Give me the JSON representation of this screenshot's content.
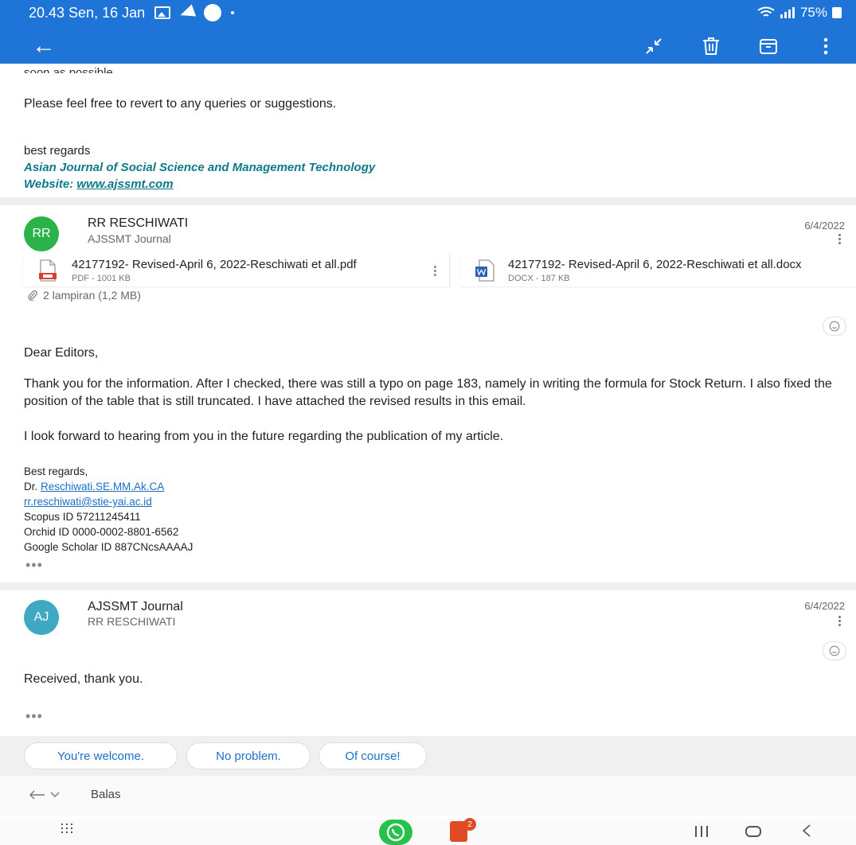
{
  "status": {
    "time_date": "20.43  Sen, 16 Jan",
    "battery": "75%"
  },
  "thread": {
    "prev_message": {
      "truncated_line": "soon as possible.",
      "body": "Please feel free to revert to any queries or suggestions.",
      "closing": "best regards",
      "org": "Asian Journal of Social Science and Management Technology",
      "website_label": "Website:",
      "website_link": "www.ajssmt.com"
    },
    "message1": {
      "avatar": "RR",
      "avatar_color": "#2bb34a",
      "sender": "RR RESCHIWATI",
      "recipient": "AJSSMT Journal",
      "date": "6/4/2022",
      "attachments": [
        {
          "name": "42177192- Revised-April 6, 2022-Reschiwati et all.pdf",
          "size": "PDF - 1001 KB"
        },
        {
          "name": "42177192- Revised-April 6, 2022-Reschiwati et all.docx",
          "size": "DOCX - 187 KB"
        }
      ],
      "attachment_count": "2 lampiran (1,2 MB)",
      "greeting": "Dear Editors,",
      "para1": "Thank you for the information. After I checked, there was still a typo on page 183, namely in writing the formula for Stock Return. I also fixed the position of the table that is still truncated. I have attached the revised results in this email.",
      "para2": "I look forward to hearing from you in the future regarding the publication of my article.",
      "signature": {
        "closing": "Best regards,",
        "title_prefix": "Dr.",
        "name_link": "Reschiwati.SE.MM.Ak.CA",
        "email_link": "rr.reschiwati@stie-yai.ac.id",
        "scopus": "Scopus ID 57211245411",
        "orchid": "Orchid ID 0000-0002-8801-6562",
        "scholar": "Google Scholar ID 887CNcsAAAAJ"
      }
    },
    "message2": {
      "avatar": "AJ",
      "avatar_color": "#3fa9c4",
      "sender": "AJSSMT Journal",
      "recipient": "RR RESCHIWATI",
      "date": "6/4/2022",
      "body": "Received, thank you."
    }
  },
  "smart_replies": [
    "You're welcome.",
    "No problem.",
    "Of course!"
  ],
  "reply": {
    "label": "Balas"
  },
  "nav": {
    "office_badge": "2"
  },
  "ellipsis": "•••",
  "colors": {
    "topbar": "#1f74d8",
    "accent_link": "#1a6fc4",
    "brand_teal": "#0e7a8a"
  }
}
